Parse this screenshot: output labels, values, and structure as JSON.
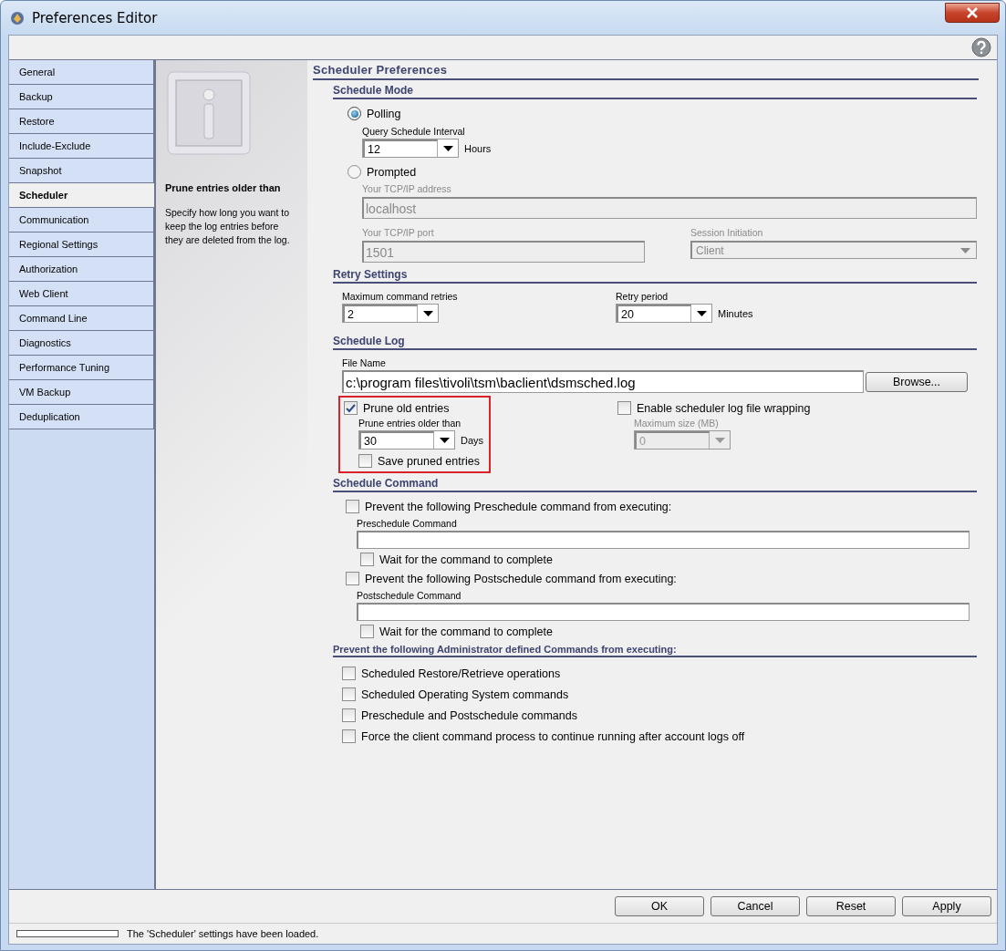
{
  "window": {
    "title": "Preferences Editor"
  },
  "sidebar": {
    "items": [
      {
        "label": "General",
        "selected": false
      },
      {
        "label": "Backup",
        "selected": false
      },
      {
        "label": "Restore",
        "selected": false
      },
      {
        "label": "Include-Exclude",
        "selected": false
      },
      {
        "label": "Snapshot",
        "selected": false
      },
      {
        "label": "Scheduler",
        "selected": true
      },
      {
        "label": "Communication",
        "selected": false
      },
      {
        "label": "Regional Settings",
        "selected": false
      },
      {
        "label": "Authorization",
        "selected": false
      },
      {
        "label": "Web Client",
        "selected": false
      },
      {
        "label": "Command Line",
        "selected": false
      },
      {
        "label": "Diagnostics",
        "selected": false
      },
      {
        "label": "Performance Tuning",
        "selected": false
      },
      {
        "label": "VM Backup",
        "selected": false
      },
      {
        "label": "Deduplication",
        "selected": false
      }
    ]
  },
  "info": {
    "heading": "Prune entries older than",
    "text": "Specify how long you want to keep the log entries before they are deleted from the log."
  },
  "form": {
    "title": "Scheduler Preferences",
    "schedule_mode": {
      "heading": "Schedule Mode",
      "options": [
        {
          "label": "Polling",
          "selected": true
        },
        {
          "label": "Prompted",
          "selected": false
        }
      ],
      "interval": {
        "label": "Query Schedule Interval",
        "value": "12",
        "unit": "Hours"
      },
      "address": {
        "label": "Your TCP/IP address",
        "value": "localhost",
        "disabled": true
      },
      "port": {
        "label": "Your TCP/IP port",
        "value": "1501",
        "disabled": true
      },
      "session": {
        "label": "Session Initiation",
        "value": "Client",
        "disabled": true
      }
    },
    "retry": {
      "heading": "Retry Settings",
      "max_retries": {
        "label": "Maximum command retries",
        "value": "2"
      },
      "period": {
        "label": "Retry period",
        "value": "20",
        "unit": "Minutes"
      }
    },
    "log": {
      "heading": "Schedule Log",
      "file_name": {
        "label": "File Name",
        "value": "c:\\program files\\tivoli\\tsm\\baclient\\dsmsched.log"
      },
      "browse": "Browse...",
      "highlighted": true,
      "prune": {
        "label": "Prune old entries",
        "checked": true
      },
      "prune_age": {
        "label": "Prune entries older than",
        "value": "30",
        "unit": "Days"
      },
      "save_pruned": {
        "label": "Save pruned entries",
        "checked": false
      },
      "wrap": {
        "label": "Enable scheduler log file wrapping",
        "checked": false
      },
      "max_size": {
        "label": "Maximum size (MB)",
        "value": "0",
        "disabled": true
      }
    },
    "command": {
      "heading": "Schedule Command",
      "blocks": [
        {
          "prevent": {
            "label": "Prevent the following Preschedule command from executing:",
            "checked": false
          },
          "field_label": "Preschedule Command",
          "wait": {
            "label": "Wait for the command to complete",
            "checked": false
          }
        },
        {
          "prevent": {
            "label": "Prevent the following Postschedule command from executing:",
            "checked": false
          },
          "field_label": "Postschedule Command",
          "wait": {
            "label": "Wait for the command to complete",
            "checked": false
          }
        }
      ]
    },
    "admin": {
      "heading": "Prevent the following Administrator defined Commands from executing:",
      "options": [
        {
          "label": "Scheduled Restore/Retrieve operations",
          "checked": false
        },
        {
          "label": "Scheduled Operating System commands",
          "checked": false
        },
        {
          "label": "Preschedule and Postschedule commands",
          "checked": false
        },
        {
          "label": "Force the client command process to continue running after account logs off",
          "checked": false
        }
      ]
    }
  },
  "buttons": [
    "OK",
    "Cancel",
    "Reset",
    "Apply"
  ],
  "status_bar": {
    "level": 0,
    "text": "The 'Scheduler' settings have been loaded."
  }
}
